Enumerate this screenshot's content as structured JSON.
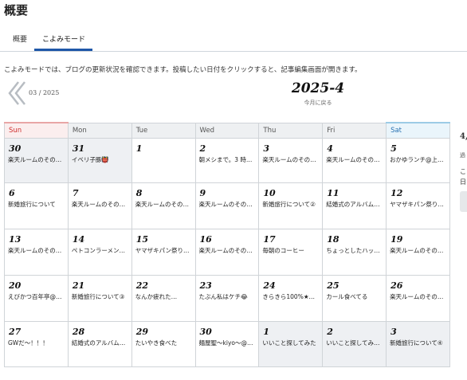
{
  "page": {
    "title": "概要"
  },
  "tabs": [
    {
      "label": "概要"
    },
    {
      "label": "こよみモード"
    }
  ],
  "description": "こよみモードでは、ブログの更新状況を確認できます。投稿したい日付をクリックすると、記事編集画面が開きます。",
  "nav": {
    "prev_label": "03 / 2025",
    "current_month": "2025-4",
    "today_label": "今月に戻る"
  },
  "colors": {
    "accent": "#1f57a8",
    "sunday": "#d0302f",
    "saturday": "#2a73b3",
    "out_of_month": "#eef0f3"
  },
  "weekdays": [
    "Sun",
    "Mon",
    "Tue",
    "Wed",
    "Thu",
    "Fri",
    "Sat"
  ],
  "weeks": [
    [
      {
        "day": "30",
        "post": "楽天ルームのその…"
      },
      {
        "day": "31",
        "post": "イベリ子豚👹"
      },
      {
        "day": "1",
        "post": ""
      },
      {
        "day": "2",
        "post": "朝メシまで。3 時…"
      },
      {
        "day": "3",
        "post": "楽天ルームのその…"
      },
      {
        "day": "4",
        "post": "楽天ルームのその…"
      },
      {
        "day": "5",
        "post": "おかゆランチ@上…"
      }
    ],
    [
      {
        "day": "6",
        "post": "新婚旅行について"
      },
      {
        "day": "7",
        "post": "楽天ルームのその…"
      },
      {
        "day": "8",
        "post": "楽天ルームのその…"
      },
      {
        "day": "9",
        "post": "楽天ルームのその…"
      },
      {
        "day": "10",
        "post": "新婚旅行について②"
      },
      {
        "day": "11",
        "post": "結婚式のアルバム…"
      },
      {
        "day": "12",
        "post": "ヤマザキパン祭り…"
      }
    ],
    [
      {
        "day": "13",
        "post": "楽天ルームのその…"
      },
      {
        "day": "14",
        "post": "ペトコンラーメン…"
      },
      {
        "day": "15",
        "post": "ヤマザキパン祭り…"
      },
      {
        "day": "16",
        "post": "楽天ルームのその…"
      },
      {
        "day": "17",
        "post": "毎朝のコーヒー"
      },
      {
        "day": "18",
        "post": "ちょっとしたハッ…"
      },
      {
        "day": "19",
        "post": "楽天ルームのその…"
      }
    ],
    [
      {
        "day": "20",
        "post": "えびかつ百年亭@…"
      },
      {
        "day": "21",
        "post": "新婚旅行について③"
      },
      {
        "day": "22",
        "post": "なんか疲れた…"
      },
      {
        "day": "23",
        "post": "たぶん私はケチ😂"
      },
      {
        "day": "24",
        "post": "きらきら100%★…"
      },
      {
        "day": "25",
        "post": "カール食べてる"
      },
      {
        "day": "26",
        "post": "楽天ルームのその…"
      }
    ],
    [
      {
        "day": "27",
        "post": "GWだ〜！！！"
      },
      {
        "day": "28",
        "post": "結婚式のアルバム…"
      },
      {
        "day": "29",
        "post": "たいやき食べた"
      },
      {
        "day": "30",
        "post": "麺屋聖〜kiyo〜@…"
      },
      {
        "day": "1",
        "post": "いいこと探してみた"
      },
      {
        "day": "2",
        "post": "いいこと探してみ…"
      },
      {
        "day": "3",
        "post": "新婚旅行について④"
      }
    ]
  ],
  "sidebar": {
    "number": "4,",
    "line1": "過",
    "line2": "こ",
    "line3": "日"
  }
}
